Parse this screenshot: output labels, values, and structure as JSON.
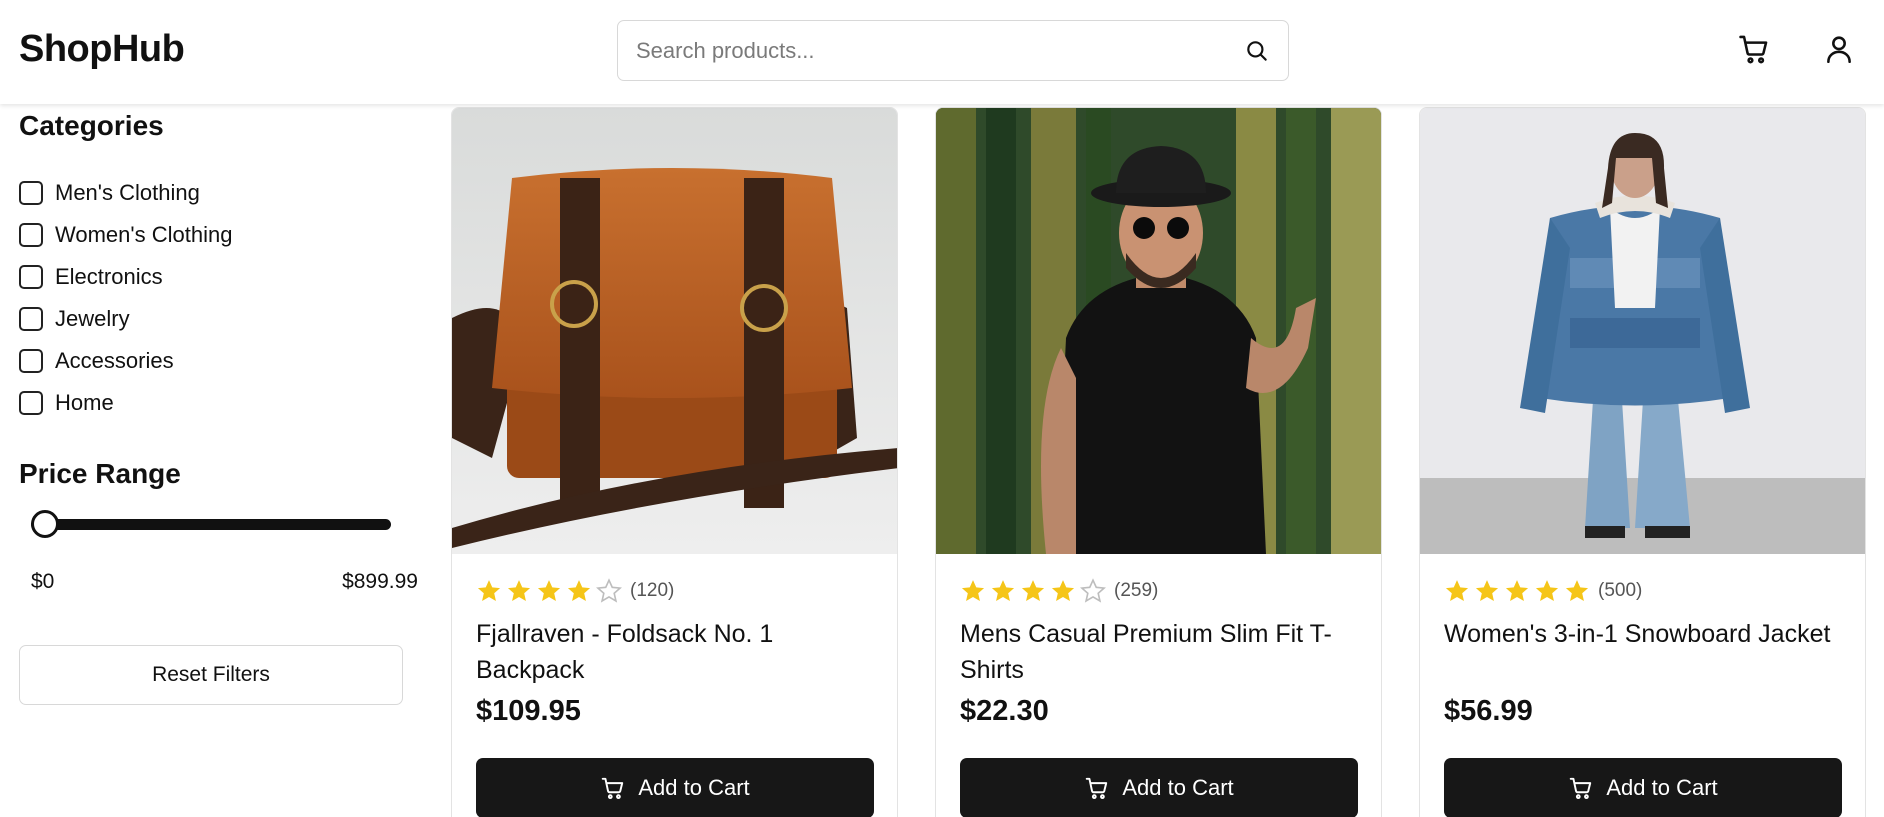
{
  "header": {
    "logo": "ShopHub",
    "search_placeholder": "Search products...",
    "icons": [
      "search-icon",
      "cart-icon",
      "user-icon"
    ]
  },
  "sidebar": {
    "categories_title": "Categories",
    "categories": [
      {
        "label": "Men's Clothing",
        "checked": false
      },
      {
        "label": "Women's Clothing",
        "checked": false
      },
      {
        "label": "Electronics",
        "checked": false
      },
      {
        "label": "Jewelry",
        "checked": false
      },
      {
        "label": "Accessories",
        "checked": false
      },
      {
        "label": "Home",
        "checked": false
      }
    ],
    "price_title": "Price Range",
    "price_min_label": "$0",
    "price_max_label": "$899.99",
    "slider_value_fraction": 0,
    "reset_label": "Reset Filters"
  },
  "products": [
    {
      "title": "Fjallraven - Foldsack No. 1 Backpack",
      "price": "$109.95",
      "rating": 4,
      "review_count": "(120)",
      "button": "Add to Cart",
      "image": "brown leather messenger bag"
    },
    {
      "title": "Mens Casual Premium Slim Fit T-Shirts",
      "price": "$22.30",
      "rating": 4,
      "review_count": "(259)",
      "button": "Add to Cart",
      "image": "man in black t-shirt and hat among bamboo"
    },
    {
      "title": "Women's 3-in-1 Snowboard Jacket",
      "price": "$56.99",
      "rating": 5,
      "review_count": "(500)",
      "button": "Add to Cart",
      "image": "person in blue denim puffer jacket"
    }
  ],
  "colors": {
    "star": "#f5c518",
    "star_empty": "#bdbdbd",
    "button_bg": "#171717",
    "text": "#111111"
  }
}
